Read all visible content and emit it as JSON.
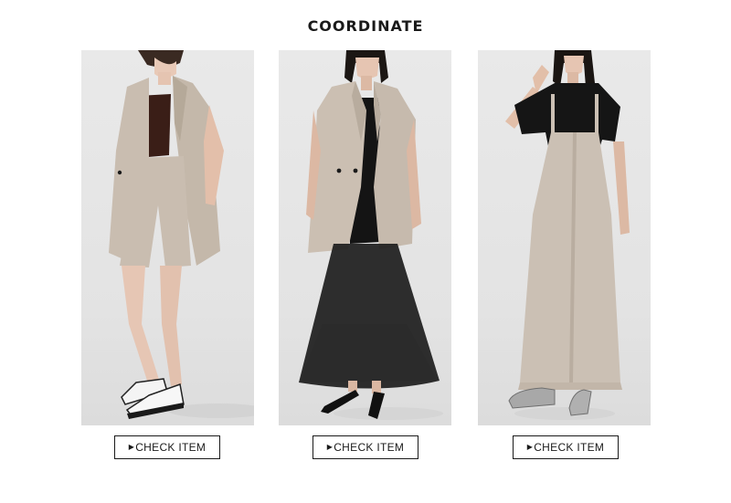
{
  "page": {
    "title": "COORDINATE"
  },
  "colors": {
    "background": "#ffffff",
    "photo_bg": "#e6e6e6",
    "button_border": "#1a1a1a",
    "beige": "#c9bfb3",
    "black": "#111111"
  },
  "looks": [
    {
      "button_label": "CHECK ITEM",
      "arrow_icon": "triangle-right-icon"
    },
    {
      "button_label": "CHECK ITEM",
      "arrow_icon": "triangle-right-icon"
    },
    {
      "button_label": "CHECK ITEM",
      "arrow_icon": "triangle-right-icon"
    }
  ]
}
